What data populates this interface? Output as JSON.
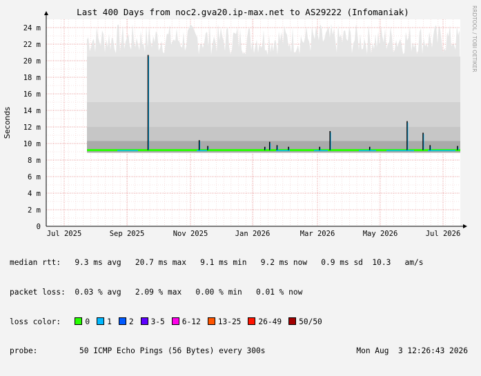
{
  "chart_data": {
    "type": "line",
    "title": "Last 400 Days from noc2.gva20.ip-max.net to AS29222 (Infomaniak)",
    "ylabel": "Seconds",
    "ylim": [
      0,
      25
    ],
    "y_ticks": [
      "0",
      "2 m",
      "4 m",
      "6 m",
      "8 m",
      "10 m",
      "12 m",
      "14 m",
      "16 m",
      "18 m",
      "20 m",
      "22 m",
      "24 m"
    ],
    "x_ticks": [
      "Jul 2025",
      "Sep 2025",
      "Nov 2025",
      "Jan 2026",
      "Mar 2026",
      "May 2026",
      "Jul 2026"
    ],
    "grid": true,
    "median_series": {
      "name": "median rtt",
      "baseline_ms": 9.2,
      "spikes": [
        {
          "x": 0.165,
          "y": 20.7
        },
        {
          "x": 0.303,
          "y": 10.4
        },
        {
          "x": 0.326,
          "y": 9.7
        },
        {
          "x": 0.48,
          "y": 9.6
        },
        {
          "x": 0.493,
          "y": 10.2
        },
        {
          "x": 0.513,
          "y": 9.8
        },
        {
          "x": 0.544,
          "y": 9.6
        },
        {
          "x": 0.628,
          "y": 9.6
        },
        {
          "x": 0.656,
          "y": 11.5
        },
        {
          "x": 0.763,
          "y": 9.6
        },
        {
          "x": 0.864,
          "y": 12.7
        },
        {
          "x": 0.907,
          "y": 11.3
        },
        {
          "x": 0.926,
          "y": 9.8
        },
        {
          "x": 1.0,
          "y": 9.7
        }
      ]
    },
    "smoke_upper_ms": 23.5
  },
  "watermark": "RRDTOOL / TOBI OETIKER",
  "stats": {
    "median_label": "median rtt:",
    "median_values": "9.3 ms avg   20.7 ms max   9.1 ms min   9.2 ms now   0.9 ms sd  10.3   am/s",
    "loss_label": "packet loss:",
    "loss_values": "0.03 % avg   2.09 % max   0.00 % min   0.01 % now",
    "color_label": "loss color:",
    "probe_label": "probe:",
    "probe_values": "50 ICMP Echo Pings (56 Bytes) every 300s",
    "timestamp": "Mon Aug  3 12:26:43 2026"
  },
  "loss_colors": [
    {
      "label": "0",
      "color": "#26ff00"
    },
    {
      "label": "1",
      "color": "#00b8ff"
    },
    {
      "label": "2",
      "color": "#0059ff"
    },
    {
      "label": "3-5",
      "color": "#5e00ff"
    },
    {
      "label": "6-12",
      "color": "#ff00ea"
    },
    {
      "label": "13-25",
      "color": "#ff5500"
    },
    {
      "label": "26-49",
      "color": "#ff1400"
    },
    {
      "label": "50/50",
      "color": "#a10000"
    }
  ]
}
